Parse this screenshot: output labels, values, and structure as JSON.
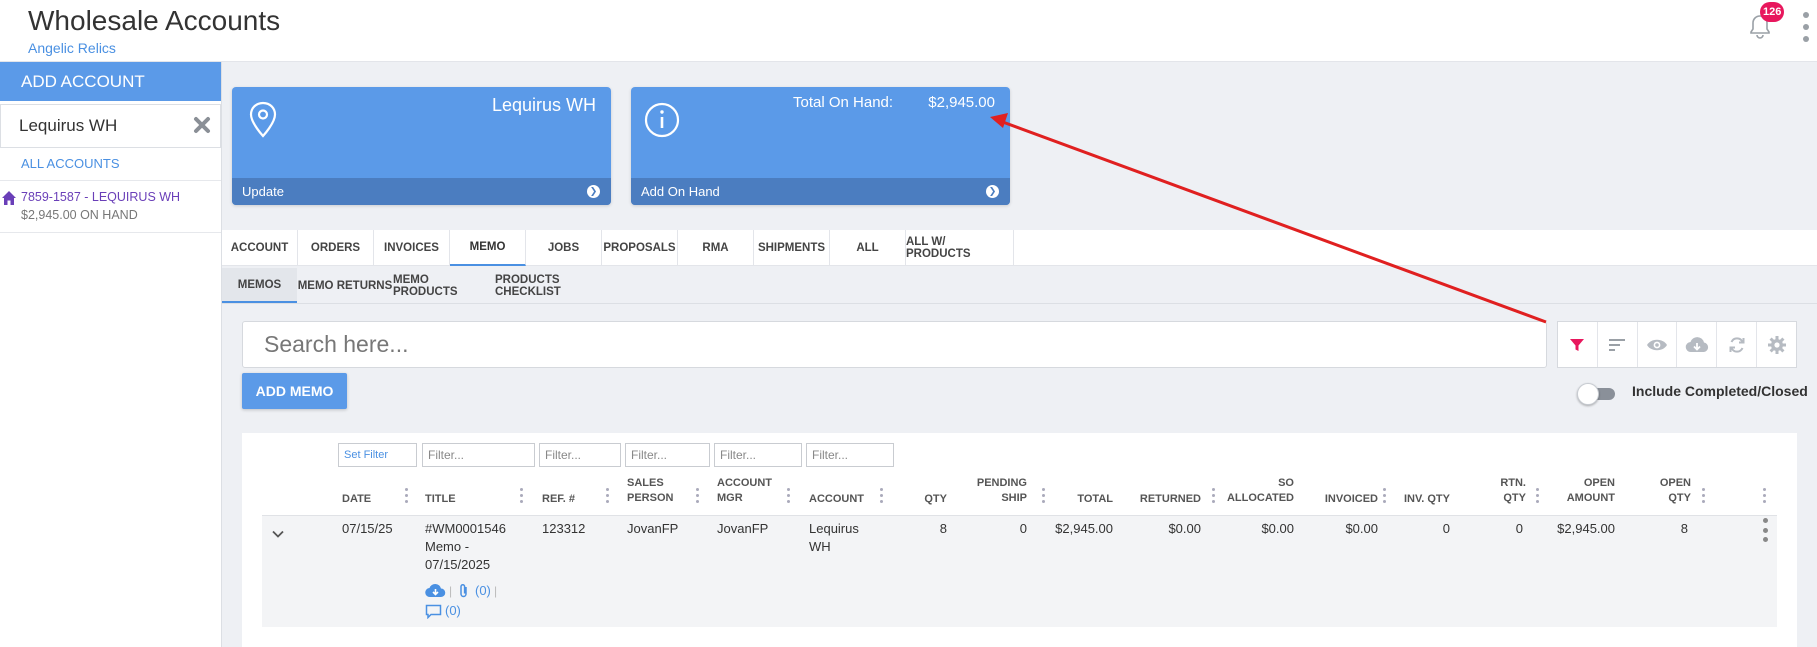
{
  "header": {
    "title": "Wholesale Accounts",
    "subtitle": "Angelic Relics",
    "notification_count": "126"
  },
  "sidebar": {
    "add_account_label": "ADD ACCOUNT",
    "selected_account": "Lequirus WH",
    "all_accounts_label": "ALL ACCOUNTS",
    "accounts": [
      {
        "name": "7859-1587 - LEQUIRUS WH",
        "sub": "$2,945.00 ON HAND"
      }
    ]
  },
  "cards": {
    "location": {
      "title": "Lequirus WH",
      "footer": "Update"
    },
    "onhand": {
      "label": "Total On Hand:",
      "value": "$2,945.00",
      "footer": "Add On Hand"
    }
  },
  "tabs": [
    "ACCOUNT",
    "ORDERS",
    "INVOICES",
    "MEMO",
    "JOBS",
    "PROPOSALS",
    "RMA",
    "SHIPMENTS",
    "ALL",
    "ALL W/ PRODUCTS"
  ],
  "active_tab": "MEMO",
  "subtabs": [
    "MEMOS",
    "MEMO RETURNS",
    "MEMO PRODUCTS",
    "PRODUCTS CHECKLIST"
  ],
  "active_subtab": "MEMOS",
  "search": {
    "placeholder": "Search here..."
  },
  "toolbar": {
    "icons": [
      "filter-icon",
      "sort-icon",
      "eye-icon",
      "cloud-download-icon",
      "refresh-icon",
      "gear-icon"
    ],
    "accent": "#e8175d"
  },
  "add_memo_label": "ADD MEMO",
  "include_completed_label": "Include Completed/Closed",
  "filters": {
    "set_filter": "Set Filter",
    "placeholder": "Filter..."
  },
  "columns": {
    "date": "DATE",
    "title": "TITLE",
    "ref": "REF. #",
    "sales_person": [
      "SALES",
      "PERSON"
    ],
    "account_mgr": [
      "ACCOUNT",
      "MGR"
    ],
    "account": "ACCOUNT",
    "qty": "QTY",
    "pending_ship": [
      "PENDING",
      "SHIP"
    ],
    "total": "TOTAL",
    "returned": "RETURNED",
    "so_allocated": [
      "SO",
      "ALLOCATED"
    ],
    "invoiced": "INVOICED",
    "inv_qty": "INV. QTY",
    "rtn_qty": [
      "RTN.",
      "QTY"
    ],
    "open_amount": [
      "OPEN",
      "AMOUNT"
    ],
    "open_qty": [
      "OPEN",
      "QTY"
    ]
  },
  "row": {
    "date": "07/15/25",
    "title_lines": [
      "#WM0001546",
      "Memo -",
      "07/15/2025"
    ],
    "ref": "123312",
    "sales_person": "JovanFP",
    "account_mgr": "JovanFP",
    "account_lines": [
      "Lequirus",
      "WH"
    ],
    "qty": "8",
    "pending_ship": "0",
    "total": "$2,945.00",
    "returned": "$0.00",
    "so_allocated": "$0.00",
    "invoiced": "$0.00",
    "inv_qty": "0",
    "rtn_qty": "0",
    "open_amount": "$2,945.00",
    "open_qty": "8",
    "attachments": "(0)",
    "comments": "(0)"
  },
  "colors": {
    "primary": "#5b9ae8",
    "link": "#4a90e2",
    "badge": "#e8175d",
    "annotation": "#e02020"
  }
}
